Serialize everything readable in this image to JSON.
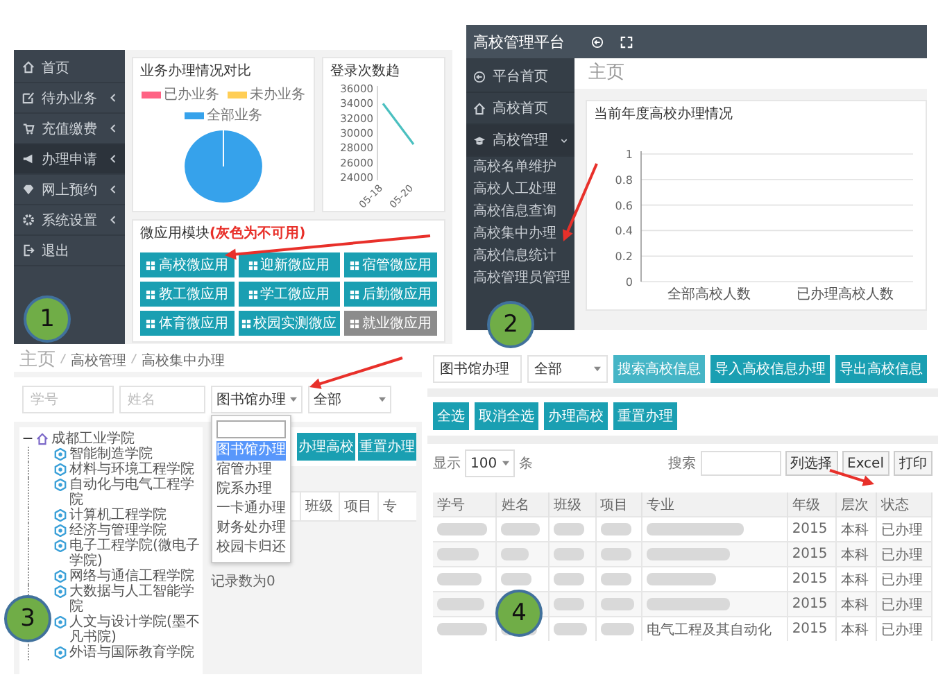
{
  "dashboard": {
    "sidebar": [
      {
        "label": "首页",
        "selected": false,
        "submenu": false
      },
      {
        "label": "待办业务",
        "selected": false,
        "submenu": true
      },
      {
        "label": "充值缴费",
        "selected": false,
        "submenu": true
      },
      {
        "label": "办理申请",
        "selected": true,
        "submenu": true
      },
      {
        "label": "网上预约",
        "selected": false,
        "submenu": true
      },
      {
        "label": "系统设置",
        "selected": false,
        "submenu": true
      },
      {
        "label": "退出",
        "selected": false,
        "submenu": false
      }
    ],
    "pie_card": {
      "title": "业务办理情况对比",
      "legend": [
        {
          "label": "已办业务",
          "color": "#ff6384"
        },
        {
          "label": "未办业务",
          "color": "#ffce56"
        },
        {
          "label": "全部业务",
          "color": "#36a2eb"
        }
      ]
    },
    "trend_card": {
      "title": "登录次数趋",
      "chart_data": {
        "type": "line",
        "categories": [
          "05-18",
          "05-20"
        ],
        "series": [
          {
            "color": "#4bc0c0",
            "values": [
              34000,
              28500
            ]
          }
        ],
        "ylim": [
          24000,
          36000
        ],
        "yticks": [
          24000,
          26000,
          28000,
          30000,
          32000,
          34000,
          36000
        ]
      }
    },
    "apps": {
      "title": "微应用模块",
      "note": "(灰色为不可用)",
      "buttons": [
        {
          "label": "高校微应用",
          "disabled": false
        },
        {
          "label": "迎新微应用",
          "disabled": false
        },
        {
          "label": "宿管微应用",
          "disabled": false
        },
        {
          "label": "教工微应用",
          "disabled": false
        },
        {
          "label": "学工微应用",
          "disabled": false
        },
        {
          "label": "后勤微应用",
          "disabled": false
        },
        {
          "label": "体育微应用",
          "disabled": false
        },
        {
          "label": "校园实测微应",
          "disabled": false
        },
        {
          "label": "就业微应用",
          "disabled": true
        }
      ]
    }
  },
  "admin": {
    "brand": "高校管理平台",
    "menu": [
      {
        "label": "平台首页"
      },
      {
        "label": "高校首页"
      },
      {
        "label": "高校管理",
        "expanded": true,
        "children": [
          {
            "label": "高校名单维护"
          },
          {
            "label": "高校人工处理"
          },
          {
            "label": "高校信息查询"
          },
          {
            "label": "高校集中办理"
          },
          {
            "label": "高校信息统计"
          },
          {
            "label": "高校管理员管理"
          }
        ]
      }
    ],
    "page_title": "主页",
    "chart_card": {
      "title": "当前年度高校办理情况",
      "chart_data": {
        "type": "bar",
        "grid": true,
        "categories": [
          "全部高校人数",
          "已办理高校人数"
        ],
        "values": [
          0,
          0
        ],
        "ylim": [
          0,
          1
        ],
        "yticks": [
          0,
          0.2,
          0.4,
          0.6,
          0.8,
          1
        ]
      }
    }
  },
  "batch": {
    "breadcrumb": [
      "主页",
      "高校管理",
      "高校集中办理"
    ],
    "filters": [
      {
        "kind": "input",
        "placeholder": "学号"
      },
      {
        "kind": "input",
        "placeholder": "姓名"
      },
      {
        "kind": "select",
        "value": "图书馆办理",
        "open": true
      },
      {
        "kind": "select",
        "value": "全部",
        "open": false
      }
    ],
    "options": [
      {
        "label": "图书馆办理",
        "selected": true
      },
      {
        "label": "宿管办理",
        "selected": false
      },
      {
        "label": "院系办理",
        "selected": false
      },
      {
        "label": "一卡通办理",
        "selected": false
      },
      {
        "label": "财务处办理",
        "selected": false
      },
      {
        "label": "校园卡归还",
        "selected": false
      }
    ],
    "tree": {
      "label": "成都工业学院",
      "expanded": true,
      "children": [
        {
          "label": "智能制造学院"
        },
        {
          "label": "材料与环境工程学院"
        },
        {
          "label": "自动化与电气工程学院"
        },
        {
          "label": "计算机工程学院"
        },
        {
          "label": "经济与管理学院"
        },
        {
          "label": "电子工程学院(微电子学院)"
        },
        {
          "label": "网络与通信工程学院"
        },
        {
          "label": "大数据与人工智能学院"
        },
        {
          "label": "人文与设计学院(墨不凡书院)"
        },
        {
          "label": "外语与国际教育学院"
        }
      ]
    },
    "buttons": [
      "办理高校",
      "重置办理"
    ],
    "columns": [
      "班级",
      "项目",
      "专"
    ],
    "record_count": "记录数为0"
  },
  "records": {
    "filters": [
      {
        "kind": "input",
        "value": "图书馆办理"
      },
      {
        "kind": "select",
        "value": "全部"
      }
    ],
    "search_buttons": [
      "搜索高校信息",
      "导入高校信息办理",
      "导出高校信息"
    ],
    "action_buttons": [
      "全选",
      "取消全选",
      "办理高校",
      "重置办理"
    ],
    "show_label": "显示",
    "page_size": "100",
    "unit": "条",
    "search_label": "搜索",
    "tools": [
      "列选择",
      "Excel",
      "打印"
    ],
    "columns": [
      "学号",
      "姓名",
      "班级",
      "项目",
      "专业",
      "年级",
      "层次",
      "状态"
    ],
    "rows": [
      {
        "grade": "2015",
        "level": "本科",
        "status": "已办理"
      },
      {
        "grade": "2015",
        "level": "本科",
        "status": "已办理"
      },
      {
        "grade": "2015",
        "level": "本科",
        "status": "已办理"
      },
      {
        "grade": "2015",
        "level": "本科",
        "status": "已办理"
      },
      {
        "major": "电气工程及其自动化",
        "grade": "2015",
        "level": "本科",
        "status": "已办理"
      }
    ]
  },
  "callouts": [
    "1",
    "2",
    "3",
    "4"
  ]
}
